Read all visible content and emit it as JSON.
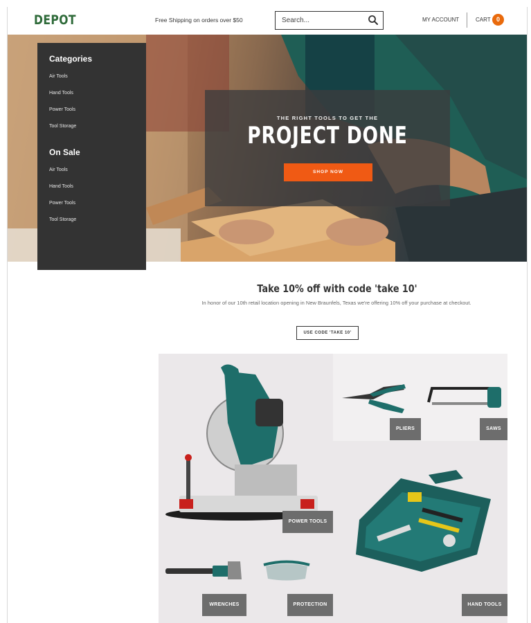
{
  "header": {
    "logo": "DEPOT",
    "shipping_notice": "Free Shipping on orders over $50",
    "search_placeholder": "Search...",
    "account_label": "MY ACCOUNT",
    "cart_label": "CART",
    "cart_count": "0"
  },
  "sidebar": {
    "categories_heading": "Categories",
    "categories": [
      "Air Tools",
      "Hand Tools",
      "Power Tools",
      "Tool Storage"
    ],
    "sale_heading": "On Sale",
    "sale_items": [
      "Air Tools",
      "Hand Tools",
      "Power Tools",
      "Tool Storage"
    ]
  },
  "hero": {
    "subtitle": "THE RIGHT TOOLS TO GET THE",
    "title": "PROJECT DONE",
    "button_label": "SHOP NOW"
  },
  "discount": {
    "title": "Take 10% off with code 'take 10'",
    "description": "In honor of our 10th retail location opening in New Braunfels, Texas we're offering 10% off your purchase at checkout.",
    "button_label": "USE CODE 'TAKE 10'"
  },
  "products": {
    "pliers": "PLIERS",
    "saws": "SAWS",
    "power_tools": "POWER TOOLS",
    "wrenches": "WRENCHES",
    "protection": "PROTECTION",
    "hand_tools": "HAND TOOLS"
  },
  "colors": {
    "brand_green": "#2f6b3a",
    "accent_orange": "#f05a14",
    "sidebar_bg": "#333333",
    "label_gray": "#6d6d6d",
    "tool_teal": "#1e6e6a"
  }
}
